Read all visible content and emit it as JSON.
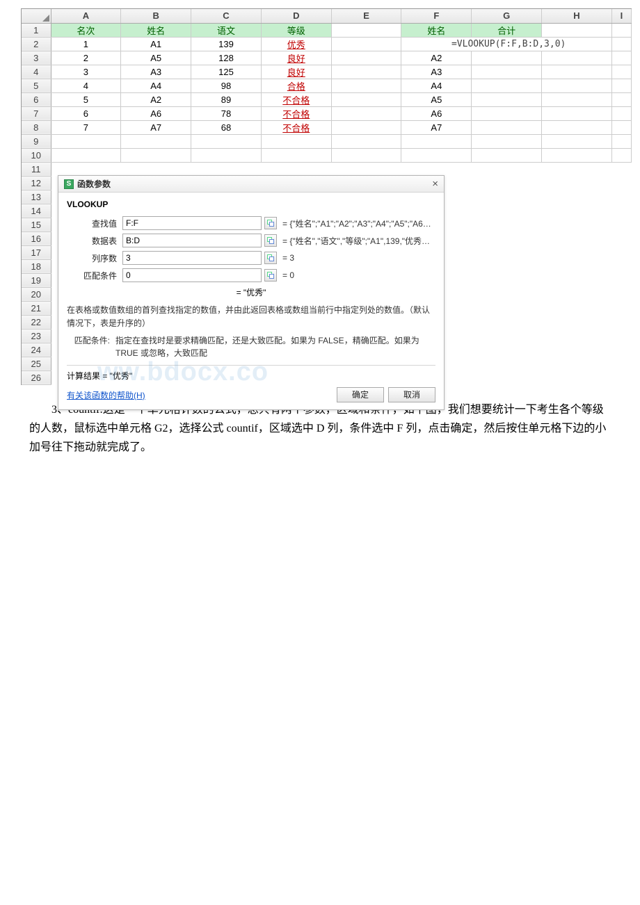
{
  "document": {
    "paragraph": "3、countif:这是一个单元格计数的公式，总共有两个参数，区域和条件，如下图，我们想要统计一下考生各个等级的人数，鼠标选中单元格 G2，选择公式 countif，区域选中 D 列，条件选中 F 列，点击确定，然后按住单元格下边的小加号往下拖动就完成了。",
    "watermark": "ww.bdocx.co"
  },
  "spreadsheet": {
    "columns": [
      "A",
      "B",
      "C",
      "D",
      "E",
      "F",
      "G",
      "H",
      "I"
    ],
    "row_count": 26,
    "header_row": {
      "A": "名次",
      "B": "姓名",
      "C": "语文",
      "D": "等级",
      "F": "姓名",
      "G": "合计"
    },
    "formula_cell": "=VLOOKUP(F:F,B:D,3,0)",
    "rows": [
      {
        "n": "1",
        "A": "1",
        "B": "A1",
        "C": "139",
        "D": "优秀",
        "F": ""
      },
      {
        "n": "2",
        "A": "2",
        "B": "A5",
        "C": "128",
        "D": "良好",
        "F": "A2"
      },
      {
        "n": "3",
        "A": "3",
        "B": "A3",
        "C": "125",
        "D": "良好",
        "F": "A3"
      },
      {
        "n": "4",
        "A": "4",
        "B": "A4",
        "C": "98",
        "D": "合格",
        "F": "A4"
      },
      {
        "n": "5",
        "A": "5",
        "B": "A2",
        "C": "89",
        "D": "不合格",
        "F": "A5"
      },
      {
        "n": "6",
        "A": "6",
        "B": "A6",
        "C": "78",
        "D": "不合格",
        "F": "A6"
      },
      {
        "n": "7",
        "A": "7",
        "B": "A7",
        "C": "68",
        "D": "不合格",
        "F": "A7"
      }
    ],
    "red_text_columns": [
      "D"
    ]
  },
  "dialog": {
    "title": "函数参数",
    "close": "×",
    "fn_name": "VLOOKUP",
    "params": [
      {
        "label": "查找值",
        "value": "F:F",
        "result": "= {\"姓名\";\"A1\";\"A2\";\"A3\";\"A4\";\"A5\";\"A6…"
      },
      {
        "label": "数据表",
        "value": "B:D",
        "result": "= {\"姓名\",\"语文\",\"等级\";\"A1\",139,\"优秀…"
      },
      {
        "label": "列序数",
        "value": "3",
        "result": "= 3"
      },
      {
        "label": "匹配条件",
        "value": "0",
        "result": "= 0"
      }
    ],
    "eval_result": "= \"优秀\"",
    "desc": "在表格或数值数组的首列查找指定的数值，并由此返回表格或数组当前行中指定列处的数值。（默认情况下，表是升序的）",
    "note_label": "匹配条件:",
    "note": "指定在查找时是要求精确匹配，还是大致匹配。如果为 FALSE，精确匹配。如果为 TRUE 或忽略，大致匹配",
    "calc_label": "计算结果 = \"优秀\"",
    "help": "有关该函数的帮助(H)",
    "ok": "确定",
    "cancel": "取消"
  }
}
